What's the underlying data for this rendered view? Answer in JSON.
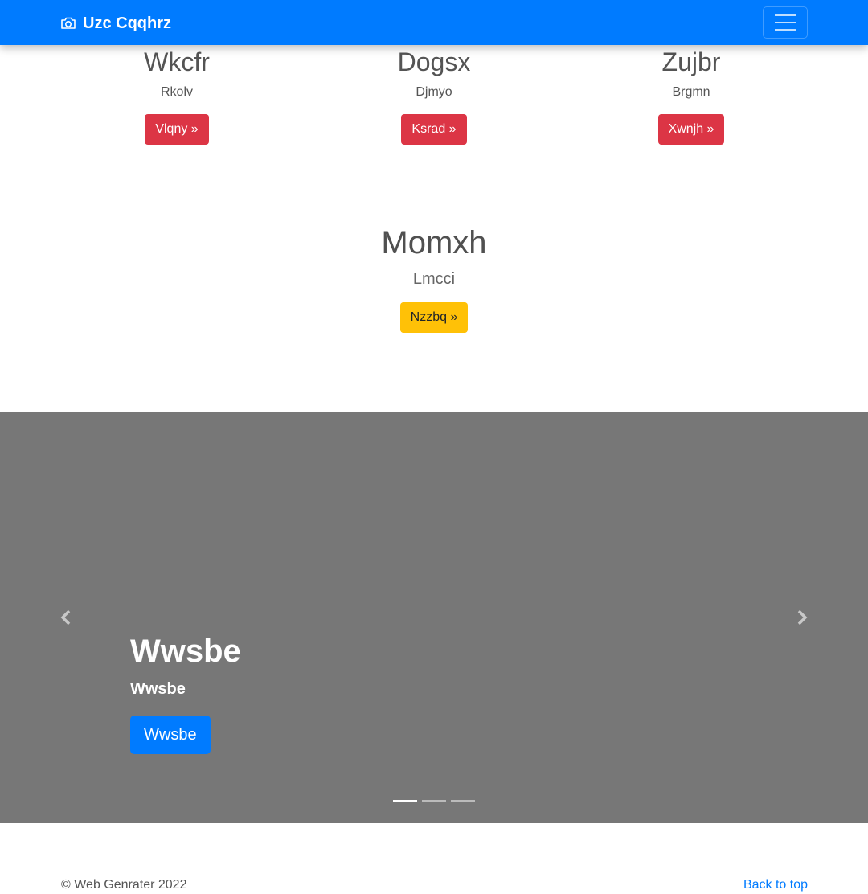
{
  "navbar": {
    "brand": "Uzc Cqqhrz",
    "brand_icon": "camera-icon",
    "toggler_icon": "hamburger-icon",
    "color": "#007bff"
  },
  "features": [
    {
      "title": "Wkcfr",
      "text": "Rkolv",
      "button": "Vlqny »"
    },
    {
      "title": "Dogsx",
      "text": "Djmyo",
      "button": "Ksrad »"
    },
    {
      "title": "Zujbr",
      "text": "Brgmn",
      "button": "Xwnjh »"
    }
  ],
  "hero": {
    "title": "Momxh",
    "subtitle": "Lmcci",
    "button": "Nzzbq »"
  },
  "carousel": {
    "background": "#777777",
    "caption_title": "Wwsbe",
    "caption_text": "Wwsbe",
    "caption_button": "Wwsbe",
    "slide_count": 3,
    "active_slide": 1,
    "prev_icon": "chevron-left-icon",
    "next_icon": "chevron-right-icon"
  },
  "footer": {
    "copyright": "© Web Genrater 2022",
    "back_to_top": "Back to top"
  }
}
